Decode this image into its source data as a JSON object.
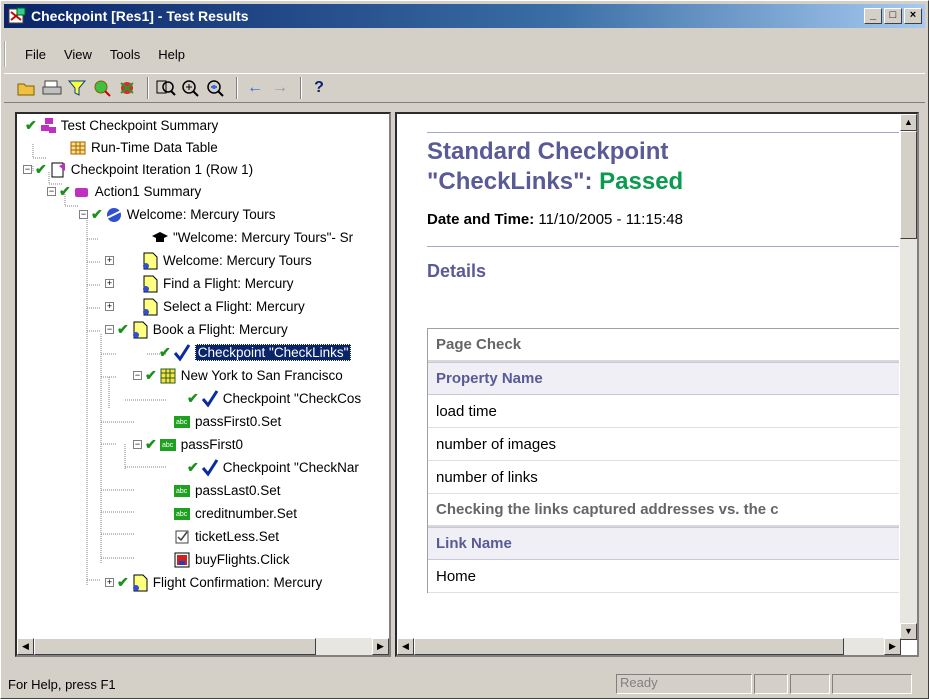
{
  "window": {
    "title": "Checkpoint [Res1] - Test Results"
  },
  "menu": [
    {
      "label": "File",
      "key": "F"
    },
    {
      "label": "View",
      "key": "V"
    },
    {
      "label": "Tools",
      "key": "T"
    },
    {
      "label": "Help",
      "key": "H"
    }
  ],
  "toolbar": [
    "open-icon",
    "print-icon",
    "filter-icon",
    "find-icon",
    "bug-icon",
    "zoom-fit-icon",
    "zoom-in-icon",
    "zoom-out-icon",
    "back-arrow-icon",
    "forward-arrow-icon",
    "help-icon"
  ],
  "tree": [
    {
      "label": "Test Checkpoint Summary"
    },
    {
      "label": "Run-Time Data Table"
    },
    {
      "label": "Checkpoint Iteration 1 (Row 1)"
    },
    {
      "label": "Action1 Summary"
    },
    {
      "label": "Welcome: Mercury Tours"
    },
    {
      "label": "\"Welcome: Mercury Tours\"- Sr"
    },
    {
      "label": "Welcome: Mercury Tours"
    },
    {
      "label": "Find a Flight: Mercury"
    },
    {
      "label": "Select a Flight: Mercury"
    },
    {
      "label": "Book a Flight: Mercury"
    },
    {
      "label": "Checkpoint \"CheckLinks\""
    },
    {
      "label": "New York to San Francisco"
    },
    {
      "label": "Checkpoint \"CheckCos"
    },
    {
      "label": "passFirst0.Set"
    },
    {
      "label": "passFirst0"
    },
    {
      "label": "Checkpoint \"CheckNar"
    },
    {
      "label": "passLast0.Set"
    },
    {
      "label": "creditnumber.Set"
    },
    {
      "label": "ticketLess.Set"
    },
    {
      "label": "buyFlights.Click"
    },
    {
      "label": "Flight Confirmation: Mercury"
    }
  ],
  "report": {
    "title_line1": "Standard Checkpoint",
    "title_line2": "\"CheckLinks\":",
    "status": "Passed",
    "date_label": "Date and Time:",
    "date_value": "11/10/2005 - 11:15:48",
    "details": "Details",
    "rows": [
      {
        "text": "Page Check",
        "kind": "sect"
      },
      {
        "text": "Property Name",
        "kind": "hdr"
      },
      {
        "text": "load time",
        "kind": "cell"
      },
      {
        "text": "number of images",
        "kind": "cell"
      },
      {
        "text": "number of links",
        "kind": "cell"
      },
      {
        "text": "Checking the links captured addresses vs. the c",
        "kind": "sect"
      },
      {
        "text": "Link Name",
        "kind": "hdr"
      },
      {
        "text": "Home",
        "kind": "cell"
      }
    ]
  },
  "status": {
    "help": "For Help, press F1",
    "ready": "Ready"
  }
}
